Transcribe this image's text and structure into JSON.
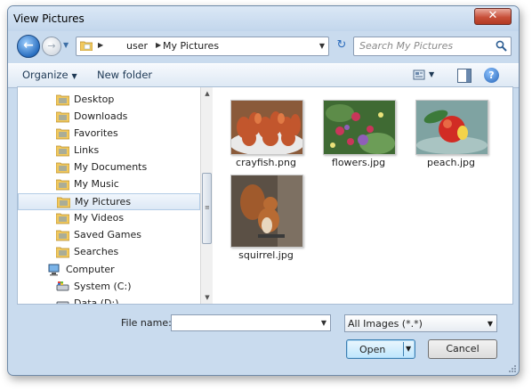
{
  "window": {
    "title": "View Pictures",
    "close_glyph": "✕"
  },
  "nav": {
    "back_icon": "back-arrow-icon",
    "forward_icon": "forward-arrow-icon",
    "breadcrumb": [
      "user",
      "My Pictures"
    ],
    "search_placeholder": "Search My Pictures"
  },
  "toolbar": {
    "organize_label": "Organize",
    "new_folder_label": "New folder",
    "help_glyph": "?"
  },
  "sidebar": {
    "items": [
      {
        "label": "Desktop",
        "icon": "desktop-folder-icon",
        "indent": 1
      },
      {
        "label": "Downloads",
        "icon": "downloads-folder-icon",
        "indent": 1
      },
      {
        "label": "Favorites",
        "icon": "favorites-folder-icon",
        "indent": 1
      },
      {
        "label": "Links",
        "icon": "links-folder-icon",
        "indent": 1
      },
      {
        "label": "My Documents",
        "icon": "documents-folder-icon",
        "indent": 1
      },
      {
        "label": "My Music",
        "icon": "music-folder-icon",
        "indent": 1
      },
      {
        "label": "My Pictures",
        "icon": "pictures-folder-icon",
        "indent": 1,
        "selected": true
      },
      {
        "label": "My Videos",
        "icon": "videos-folder-icon",
        "indent": 1
      },
      {
        "label": "Saved Games",
        "icon": "games-folder-icon",
        "indent": 1
      },
      {
        "label": "Searches",
        "icon": "searches-folder-icon",
        "indent": 1
      },
      {
        "label": "Computer",
        "icon": "computer-icon",
        "indent": 0
      },
      {
        "label": "System (C:)",
        "icon": "system-drive-icon",
        "indent": 1
      },
      {
        "label": "Data (D:)",
        "icon": "data-drive-icon",
        "indent": 1
      }
    ]
  },
  "files": [
    {
      "name": "crayfish.png"
    },
    {
      "name": "flowers.jpg"
    },
    {
      "name": "peach.jpg"
    },
    {
      "name": "squirrel.jpg"
    }
  ],
  "footer": {
    "file_name_label": "File name:",
    "file_name_value": "",
    "file_type_selected": "All Images (*.*)",
    "open_label": "Open",
    "cancel_label": "Cancel"
  }
}
